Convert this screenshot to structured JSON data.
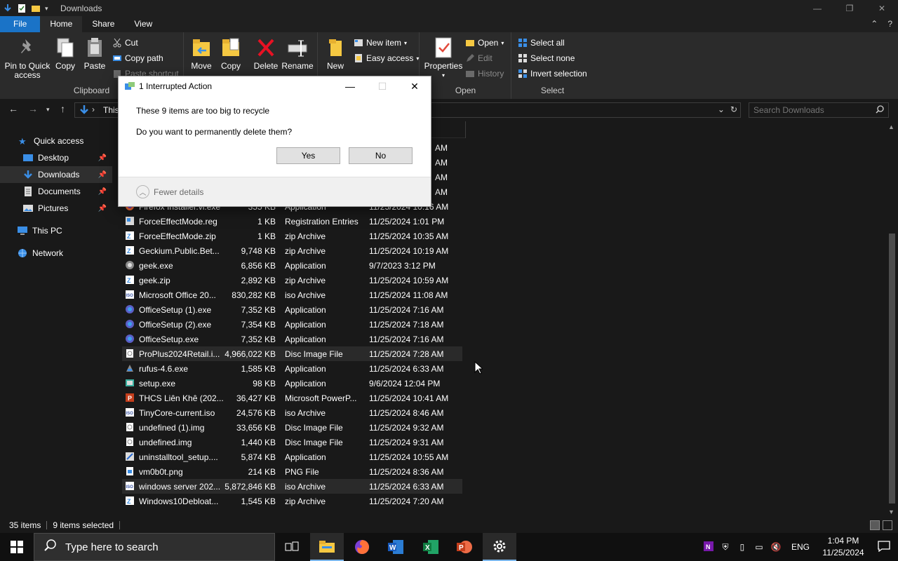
{
  "window": {
    "title": "Downloads",
    "controls": [
      "—",
      "❐",
      "✕"
    ]
  },
  "tabs": [
    "File",
    "Home",
    "Share",
    "View"
  ],
  "ribbon": {
    "clipboard": {
      "label": "Clipboard",
      "pin": "Pin to Quick access",
      "pin_l1": "Pin to Quick",
      "pin_l2": "access",
      "copy": "Copy",
      "paste": "Paste",
      "cut": "Cut",
      "copy_path": "Copy path",
      "paste_shortcut": "Paste shortcut"
    },
    "organize": {
      "move": "Move",
      "copy": "Copy",
      "delete": "Delete",
      "rename": "Rename"
    },
    "new": {
      "new_folder": "New",
      "new_item": "New item",
      "easy_access": "Easy access"
    },
    "open": {
      "label": "Open",
      "properties": "Properties",
      "open": "Open",
      "edit": "Edit",
      "history": "History"
    },
    "select": {
      "label": "Select",
      "select_all": "Select all",
      "select_none": "Select none",
      "invert": "Invert selection"
    }
  },
  "address": {
    "crumb": "This",
    "search_placeholder": "Search Downloads"
  },
  "navpane": {
    "quick_access": "Quick access",
    "desktop": "Desktop",
    "downloads": "Downloads",
    "documents": "Documents",
    "pictures": "Pictures",
    "this_pc": "This PC",
    "network": "Network"
  },
  "files": [
    {
      "name": "Firefox Installer.vi.exe",
      "size": "355 KB",
      "type": "Application",
      "date": "11/25/2024 10:16 AM",
      "icon": "firefox-icon",
      "hl": false
    },
    {
      "name": "ForceEffectMode.reg",
      "size": "1 KB",
      "type": "Registration Entries",
      "date": "11/25/2024 1:01 PM",
      "icon": "registry-icon",
      "hl": false
    },
    {
      "name": "ForceEffectMode.zip",
      "size": "1 KB",
      "type": "zip Archive",
      "date": "11/25/2024 10:35 AM",
      "icon": "zip-icon",
      "hl": false
    },
    {
      "name": "Geckium.Public.Bet...",
      "size": "9,748 KB",
      "type": "zip Archive",
      "date": "11/25/2024 10:19 AM",
      "icon": "zip-icon",
      "hl": false
    },
    {
      "name": "geek.exe",
      "size": "6,856 KB",
      "type": "Application",
      "date": "9/7/2023 3:12 PM",
      "icon": "app-icon",
      "hl": false
    },
    {
      "name": "geek.zip",
      "size": "2,892 KB",
      "type": "zip Archive",
      "date": "11/25/2024 10:59 AM",
      "icon": "zip-icon",
      "hl": false
    },
    {
      "name": "Microsoft Office 20...",
      "size": "830,282 KB",
      "type": "iso Archive",
      "date": "11/25/2024 11:08 AM",
      "icon": "iso-icon",
      "hl": false
    },
    {
      "name": "OfficeSetup (1).exe",
      "size": "7,352 KB",
      "type": "Application",
      "date": "11/25/2024 7:16 AM",
      "icon": "office-icon",
      "hl": false
    },
    {
      "name": "OfficeSetup (2).exe",
      "size": "7,354 KB",
      "type": "Application",
      "date": "11/25/2024 7:18 AM",
      "icon": "office-icon",
      "hl": false
    },
    {
      "name": "OfficeSetup.exe",
      "size": "7,352 KB",
      "type": "Application",
      "date": "11/25/2024 7:16 AM",
      "icon": "office-icon",
      "hl": false
    },
    {
      "name": "ProPlus2024Retail.i...",
      "size": "4,966,022 KB",
      "type": "Disc Image File",
      "date": "11/25/2024 7:28 AM",
      "icon": "disc-icon",
      "hl": true
    },
    {
      "name": "rufus-4.6.exe",
      "size": "1,585 KB",
      "type": "Application",
      "date": "11/25/2024 6:33 AM",
      "icon": "rufus-icon",
      "hl": false
    },
    {
      "name": "setup.exe",
      "size": "98 KB",
      "type": "Application",
      "date": "9/6/2024 12:04 PM",
      "icon": "setup-icon",
      "hl": false
    },
    {
      "name": "THCS Liên Khê (202...",
      "size": "36,427 KB",
      "type": "Microsoft PowerP...",
      "date": "11/25/2024 10:41 AM",
      "icon": "powerpoint-icon",
      "hl": false
    },
    {
      "name": "TinyCore-current.iso",
      "size": "24,576 KB",
      "type": "iso Archive",
      "date": "11/25/2024 8:46 AM",
      "icon": "iso-icon",
      "hl": false
    },
    {
      "name": "undefined (1).img",
      "size": "33,656 KB",
      "type": "Disc Image File",
      "date": "11/25/2024 9:32 AM",
      "icon": "disc-icon",
      "hl": false
    },
    {
      "name": "undefined.img",
      "size": "1,440 KB",
      "type": "Disc Image File",
      "date": "11/25/2024 9:31 AM",
      "icon": "disc-icon",
      "hl": false
    },
    {
      "name": "uninstalltool_setup....",
      "size": "5,874 KB",
      "type": "Application",
      "date": "11/25/2024 10:55 AM",
      "icon": "installer-icon",
      "hl": false
    },
    {
      "name": "vm0b0t.png",
      "size": "214 KB",
      "type": "PNG File",
      "date": "11/25/2024 8:36 AM",
      "icon": "image-icon",
      "hl": false
    },
    {
      "name": "windows server 202...",
      "size": "5,872,846 KB",
      "type": "iso Archive",
      "date": "11/25/2024 6:33 AM",
      "icon": "iso-icon",
      "hl": true
    },
    {
      "name": "Windows10Debloat...",
      "size": "1,545 KB",
      "type": "zip Archive",
      "date": "11/25/2024 7:20 AM",
      "icon": "zip-icon",
      "hl": false
    }
  ],
  "partial_rows_times": [
    "AM",
    "AM",
    "AM",
    "AM"
  ],
  "status": {
    "count": "35 items",
    "selected": "9 items selected"
  },
  "dialog": {
    "title": "1 Interrupted Action",
    "message1": "These 9 items are too big to recycle",
    "message2": "Do you want to permanently delete them?",
    "yes": "Yes",
    "no": "No",
    "fewer_details": "Fewer details"
  },
  "taskbar": {
    "search_placeholder": "Type here to search",
    "time": "1:04 PM",
    "date": "11/25/2024",
    "lang": "ENG"
  },
  "colors": {
    "accent": "#1a73c7",
    "bg": "#191919",
    "ribbon": "#2b2b2b",
    "taskbar": "#101010"
  }
}
